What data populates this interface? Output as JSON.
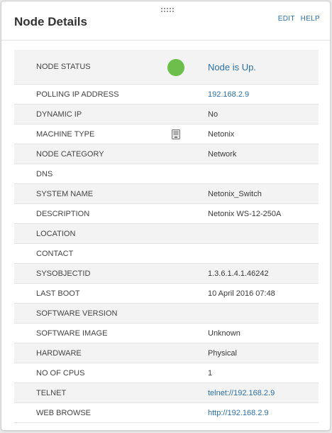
{
  "header": {
    "title": "Node Details",
    "edit_label": "EDIT",
    "help_label": "HELP"
  },
  "colors": {
    "accent_link": "#2a6fa8",
    "status_up": "#6cbf4a"
  },
  "rows": [
    {
      "label": "NODE STATUS",
      "value": "Node is Up."
    },
    {
      "label": "POLLING IP ADDRESS",
      "value": "192.168.2.9"
    },
    {
      "label": "DYNAMIC IP",
      "value": "No"
    },
    {
      "label": "MACHINE TYPE",
      "value": "Netonix",
      "icon": "server-tower-icon"
    },
    {
      "label": "NODE CATEGORY",
      "value": "Network"
    },
    {
      "label": "DNS",
      "value": ""
    },
    {
      "label": "SYSTEM NAME",
      "value": "Netonix_Switch"
    },
    {
      "label": "DESCRIPTION",
      "value": "Netonix WS-12-250A"
    },
    {
      "label": "LOCATION",
      "value": ""
    },
    {
      "label": "CONTACT",
      "value": ""
    },
    {
      "label": "SYSOBJECTID",
      "value": "1.3.6.1.4.1.46242"
    },
    {
      "label": "LAST BOOT",
      "value": "10 April 2016 07:48"
    },
    {
      "label": "SOFTWARE VERSION",
      "value": ""
    },
    {
      "label": "SOFTWARE IMAGE",
      "value": "Unknown"
    },
    {
      "label": "HARDWARE",
      "value": "Physical"
    },
    {
      "label": "NO OF CPUS",
      "value": "1"
    },
    {
      "label": "TELNET",
      "value": "telnet://192.168.2.9"
    },
    {
      "label": "WEB BROWSE",
      "value": "http://192.168.2.9"
    }
  ]
}
